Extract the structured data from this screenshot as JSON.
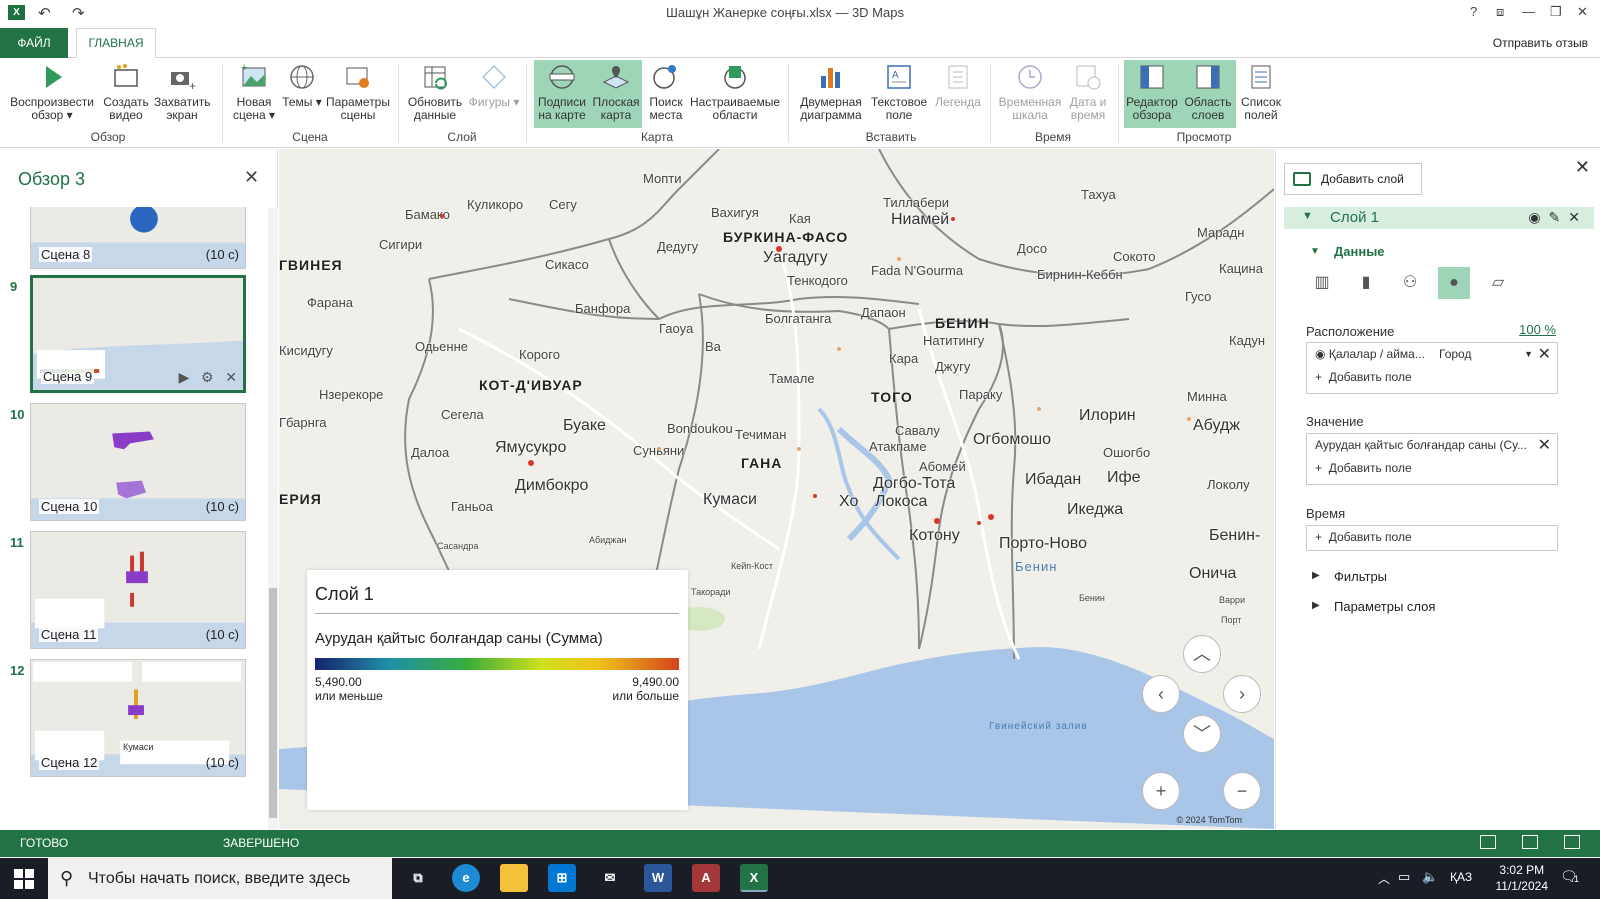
{
  "window": {
    "title": "Шашұн Жанерке соңғы.xlsx — 3D Maps",
    "controls": [
      "?",
      "⧈",
      "—",
      "❐",
      "✕"
    ]
  },
  "tabs": {
    "file": "ФАЙЛ",
    "home": "ГЛАВНАЯ",
    "feedback": "Отправить отзыв"
  },
  "ribbon": {
    "play_tour": "Воспроизвести обзор ▾",
    "create_video": "Создать видео",
    "capture_screen": "Захватить экран",
    "group_tour": "Обзор",
    "new_scene": "Новая сцена ▾",
    "themes": "Темы ▾",
    "scene_options": "Параметры сцены",
    "group_scene": "Сцена",
    "refresh_data": "Обновить данные",
    "shapes": "Фигуры ▾",
    "group_layer": "Слой",
    "map_labels": "Подписи на карте",
    "flat_map": "Плоская карта",
    "find_location": "Поиск места",
    "custom_regions": "Настраиваемые области",
    "group_map": "Карта",
    "chart_2d": "Двумерная диаграмма",
    "text_box": "Текстовое поле",
    "legend": "Легенда",
    "group_insert": "Вставить",
    "timeline": "Временная шкала",
    "date_time": "Дата и время",
    "group_time": "Время",
    "tour_editor": "Редактор обзора",
    "layer_pane": "Область слоев",
    "field_list": "Список полей",
    "group_view": "Просмотр"
  },
  "tour": {
    "title": "Обзор 3",
    "scenes": [
      {
        "num": "",
        "label": "Сцена 8",
        "duration": "(10 с)"
      },
      {
        "num": "9",
        "label": "Сцена 9",
        "duration": ""
      },
      {
        "num": "10",
        "label": "Сцена 10",
        "duration": "(10 с)"
      },
      {
        "num": "11",
        "label": "Сцена 11",
        "duration": "(10 с)"
      },
      {
        "num": "12",
        "label": "Сцена 12",
        "duration": "(10 с)"
      }
    ],
    "scene12_caption": "Кумаси"
  },
  "map": {
    "countries": [
      "КОТ-Д'ИВУАР",
      "БУРКИНА-ФАСО",
      "ГАНА",
      "ТОГО",
      "БЕНИН",
      "ГВИНЕЯ",
      "ЕРИЯ"
    ],
    "cities": [
      "Мопти",
      "Куликоро",
      "Сегу",
      "Бамако",
      "Вахигуя",
      "Кая",
      "Тиллабери",
      "Таxуа",
      "Ниамей",
      "Марадн",
      "Сигири",
      "Сикасо",
      "Дедугу",
      "Уагадугу",
      "Тенкодого",
      "Fada N'Gourma",
      "Досо",
      "Бирнин-Кеббн",
      "Сокото",
      "Кацина",
      "Гусо",
      "Фарана",
      "Банфора",
      "Гаоуа",
      "Ва",
      "Болгатанга",
      "Дапаон",
      "Натитингу",
      "Кадун",
      "Кисидугу",
      "Одьенне",
      "Корого",
      "Тамале",
      "Кара",
      "Джугу",
      "Параку",
      "Минна",
      "Нзерекоре",
      "Сегела",
      "Буаке",
      "Bondoukou",
      "Течиман",
      "Савалу",
      "Огбомошо",
      "Илорин",
      "Абудж",
      "Гбарнга",
      "Далоа",
      "Ямусукро",
      "Суньяни",
      "Атакпаме",
      "Абомей",
      "Ошогбо",
      "Ифе",
      "Локолу",
      "Ганьоа",
      "Димбокро",
      "Кумаси",
      "Догбо-Тота",
      "Хо",
      "Локоса",
      "Ибадан",
      "Икеджа",
      "Бенин-",
      "Котону",
      "Порто-Ново",
      "Бенин",
      "Онича",
      "Сасандра",
      "Абиджан",
      "Кейп-Кост",
      "Такоради",
      "Варри",
      "Порт",
      "Бенин"
    ],
    "sea": "Гвинейский залив",
    "copyright": "© 2024 TomTom"
  },
  "legend": {
    "title": "Слой 1",
    "field": "Аурудан қайтыс болғандар саны (Сумма)",
    "min": "5,490.00",
    "min_note": "или меньше",
    "max": "9,490.00",
    "max_note": "или больше",
    "gradient_colors": [
      "#16216e",
      "#1f8fa8",
      "#3aad3a",
      "#cfe01e",
      "#f0c21a",
      "#d3441d"
    ]
  },
  "layers": {
    "add_layer": "Добавить слой",
    "layer_name": "Слой 1",
    "data_section": "Данные",
    "location_label": "Расположение",
    "location_percent": "100 %",
    "location_field": "Қалалар / айма...",
    "location_type": "Город",
    "add_field": "Добавить поле",
    "value_label": "Значение",
    "value_field": "Аурудан қайтыс болғандар саны (Су...",
    "time_label": "Время",
    "filters": "Фильтры",
    "layer_options": "Параметры слоя"
  },
  "status": {
    "left": "ГОТОВО",
    "right": "ЗАВЕРШЕНО"
  },
  "taskbar": {
    "search_placeholder": "Чтобы начать поиск, введите здесь запрос",
    "lang": "ҚАЗ",
    "time": "3:02 PM",
    "date": "11/1/2024",
    "notifications": "1"
  }
}
